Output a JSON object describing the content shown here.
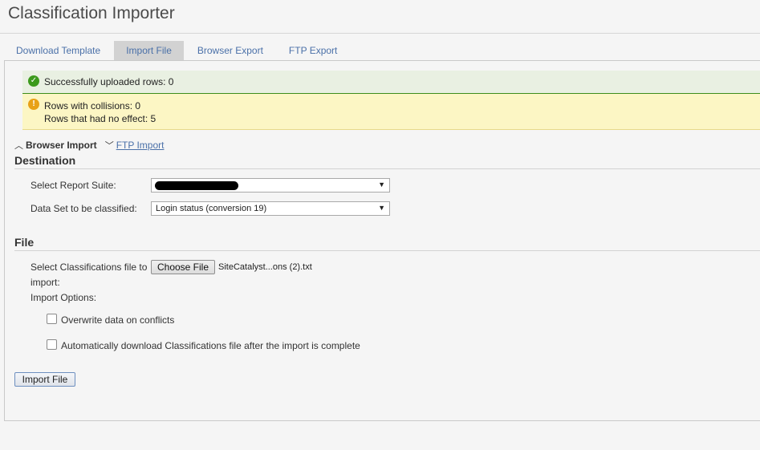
{
  "app": {
    "title": "Classification Importer"
  },
  "tabs": [
    {
      "label": "Download Template",
      "active": false
    },
    {
      "label": "Import File",
      "active": true
    },
    {
      "label": "Browser Export",
      "active": false
    },
    {
      "label": "FTP Export",
      "active": false
    }
  ],
  "messages": {
    "success": "Successfully uploaded rows: 0",
    "warning_line1": "Rows with collisions: 0",
    "warning_line2": "Rows that had no effect: 5"
  },
  "sections": {
    "browser_import": "Browser Import",
    "ftp_import": "FTP Import"
  },
  "destination": {
    "heading": "Destination",
    "report_suite_label": "Select Report Suite:",
    "report_suite_value": "",
    "data_set_label": "Data Set to be classified:",
    "data_set_value": "Login status (conversion 19)"
  },
  "file": {
    "heading": "File",
    "select_label_line1": "Select Classifications file to",
    "select_label_line2": "import:",
    "choose_button": "Choose File",
    "file_name": "SiteCatalyst...ons (2).txt",
    "import_options_label": "Import Options:",
    "option_overwrite": "Overwrite data on conflicts",
    "option_overwrite_checked": false,
    "option_autodownload": "Automatically download Classifications file after the import is complete",
    "option_autodownload_checked": false
  },
  "actions": {
    "import_button": "Import File"
  },
  "colors": {
    "link": "#4a70a8",
    "success_bg": "#e9f0e2",
    "success_icon": "#3c9a1c",
    "warning_bg": "#fcf6c4",
    "warning_icon": "#e8a117",
    "active_tab": "#d2d2d2"
  }
}
